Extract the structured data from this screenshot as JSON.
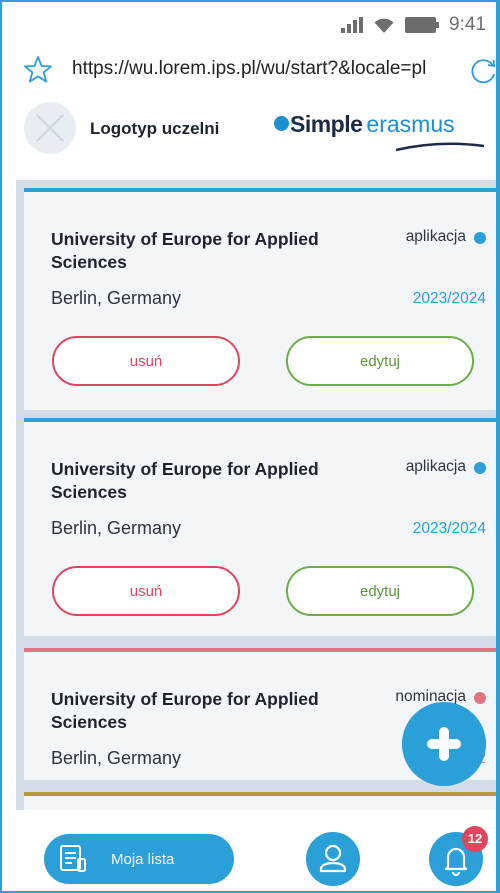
{
  "status_bar": {
    "time": "9:41"
  },
  "browser": {
    "url": "https://wu.lorem.ips.pl/wu/start?&locale=pl"
  },
  "header": {
    "logo_label": "Logotyp uczelni",
    "brand_part1": "Simple",
    "brand_part2": "erasmus"
  },
  "cards": [
    {
      "name": "University of Europe for Applied Sciences",
      "city": "Berlin, Germany",
      "status": "aplikacja",
      "year": "2023/2024",
      "delete_label": "usuń",
      "edit_label": "edytuj",
      "accent": "#2a9fd8"
    },
    {
      "name": "University of Europe for Applied Sciences",
      "city": "Berlin, Germany",
      "status": "aplikacja",
      "year": "2023/2024",
      "delete_label": "usuń",
      "edit_label": "edytuj",
      "accent": "#2a9fd8"
    },
    {
      "name": "University of Europe for Applied Sciences",
      "city": "Berlin, Germany",
      "status": "nominacja",
      "year": "2",
      "accent": "#e27381"
    }
  ],
  "bottom_nav": {
    "my_list_label": "Moja lista",
    "notifications_count": "12"
  },
  "colors": {
    "primary": "#2a9fd8",
    "danger": "#e0465e",
    "success": "#6cad48",
    "nomination": "#e27381"
  }
}
